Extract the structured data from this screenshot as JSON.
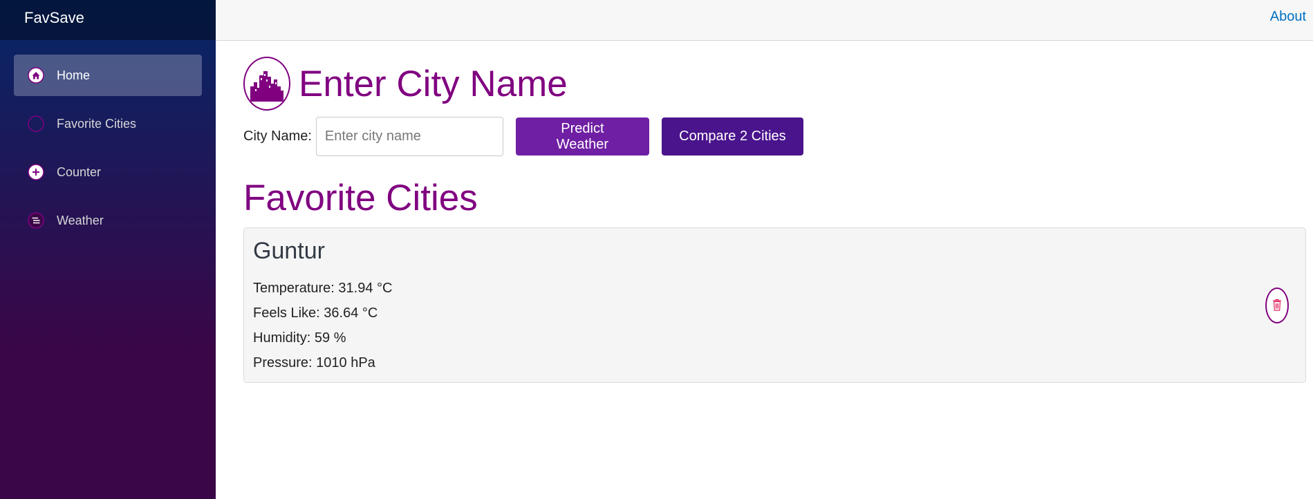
{
  "brand": "FavSave",
  "nav": [
    {
      "label": "Home",
      "icon": "home-icon"
    },
    {
      "label": "Favorite Cities",
      "icon": "circle-icon"
    },
    {
      "label": "Counter",
      "icon": "plus-circle-icon"
    },
    {
      "label": "Weather",
      "icon": "list-icon"
    }
  ],
  "topbar": {
    "about": "About"
  },
  "hero": {
    "title": "Enter City Name",
    "icon": "city-skyline-icon"
  },
  "search": {
    "label": "City Name:",
    "placeholder": "Enter city name",
    "value": "",
    "predict_label": "Predict Weather",
    "compare_label": "Compare 2 Cities"
  },
  "favorites": {
    "title": "Favorite Cities",
    "cards": [
      {
        "city": "Guntur",
        "temperature": "Temperature: 31.94 °C",
        "feels_like": "Feels Like: 36.64 °C",
        "humidity": "Humidity: 59 %",
        "pressure": "Pressure: 1010 hPa",
        "delete_icon": "trash-icon"
      }
    ]
  },
  "colors": {
    "accent": "#800080",
    "predict_button": "#6f1fa3",
    "compare_button": "#4a148c",
    "link": "#0071c1",
    "delete": "#e0245e"
  }
}
